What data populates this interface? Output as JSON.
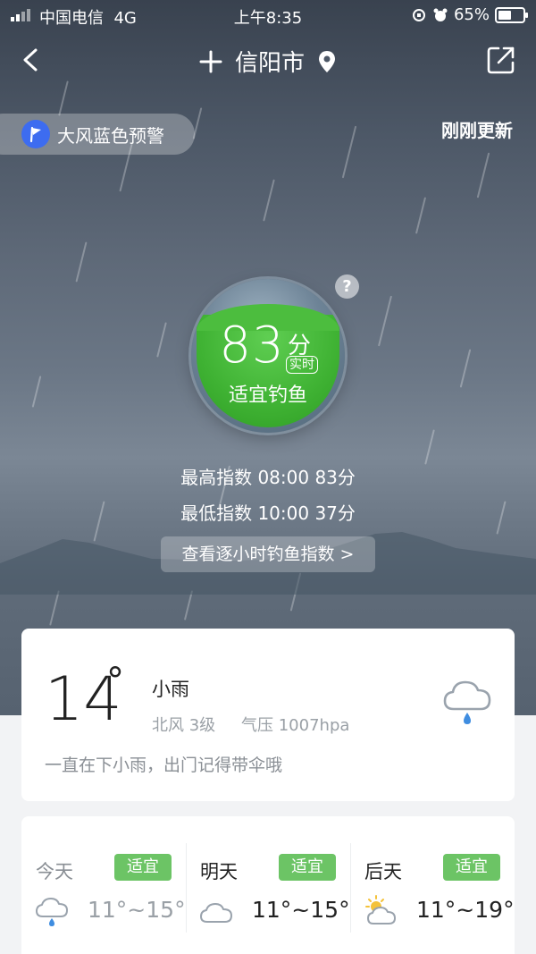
{
  "status_bar": {
    "carrier": "中国电信",
    "network": "4G",
    "time": "上午8:35",
    "battery": "65%",
    "battery_level": 0.65
  },
  "nav": {
    "city": "信阳市"
  },
  "warning": {
    "label": "大风蓝色预警"
  },
  "updated_label": "刚刚更新",
  "score": {
    "value": "83",
    "unit": "分",
    "realtime_tag": "实时",
    "label": "适宜钓鱼",
    "help": "?"
  },
  "index": {
    "max": "最高指数 08:00 83分",
    "min": "最低指数 10:00 37分",
    "hourly_link": "查看逐小时钓鱼指数 >"
  },
  "current": {
    "temp": "14",
    "degree": "°",
    "description": "小雨",
    "wind": "北风 3级",
    "pressure": "气压 1007hpa",
    "tip": "一直在下小雨，出门记得带伞哦",
    "icon": "rain-cloud-icon"
  },
  "forecast": [
    {
      "day": "今天",
      "badge": "适宜",
      "range": "11°~15°",
      "icon": "rain-cloud-icon"
    },
    {
      "day": "明天",
      "badge": "适宜",
      "range": "11°~15°",
      "icon": "cloud-icon"
    },
    {
      "day": "后天",
      "badge": "适宜",
      "range": "11°~19°",
      "icon": "sun-cloud-icon"
    }
  ],
  "colors": {
    "accent_green": "#4cbd3e",
    "badge_green": "#6cc465",
    "warning_blue": "#3d6cf0"
  }
}
